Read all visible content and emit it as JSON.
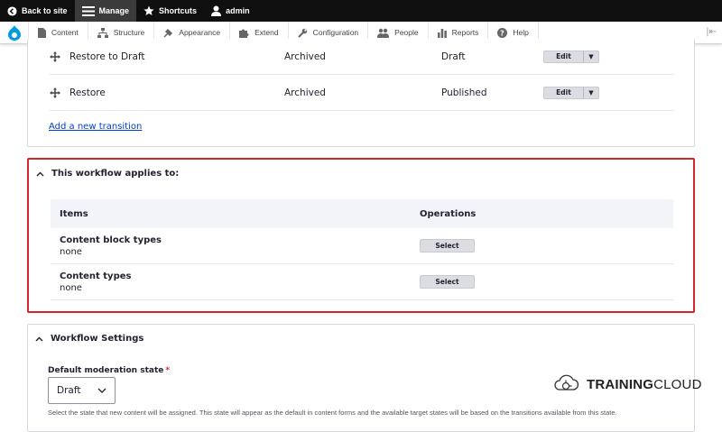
{
  "toolbar": {
    "back": "Back to site",
    "manage": "Manage",
    "shortcuts": "Shortcuts",
    "user": "admin"
  },
  "tray": {
    "items": [
      "Content",
      "Structure",
      "Appearance",
      "Extend",
      "Configuration",
      "People",
      "Reports",
      "Help"
    ]
  },
  "transitions": {
    "rows": [
      {
        "name": "Restore to Draft",
        "from": "Archived",
        "to": "Draft",
        "action": "Edit"
      },
      {
        "name": "Restore",
        "from": "Archived",
        "to": "Published",
        "action": "Edit"
      }
    ],
    "add_link": "Add a new transition"
  },
  "applies": {
    "title": "This workflow applies to:",
    "col_items": "Items",
    "col_operations": "Operations",
    "rows": [
      {
        "type": "Content block types",
        "value": "none",
        "button": "Select"
      },
      {
        "type": "Content types",
        "value": "none",
        "button": "Select"
      }
    ]
  },
  "settings": {
    "title": "Workflow Settings",
    "field_label": "Default moderation state",
    "required_mark": "*",
    "selected": "Draft",
    "help": "Select the state that new content will be assigned. This state will appear as the default in content forms and the available target states will be based on the transitions available from this state."
  },
  "watermark": {
    "bold": "TRAINING",
    "rest": "CLOUD"
  }
}
